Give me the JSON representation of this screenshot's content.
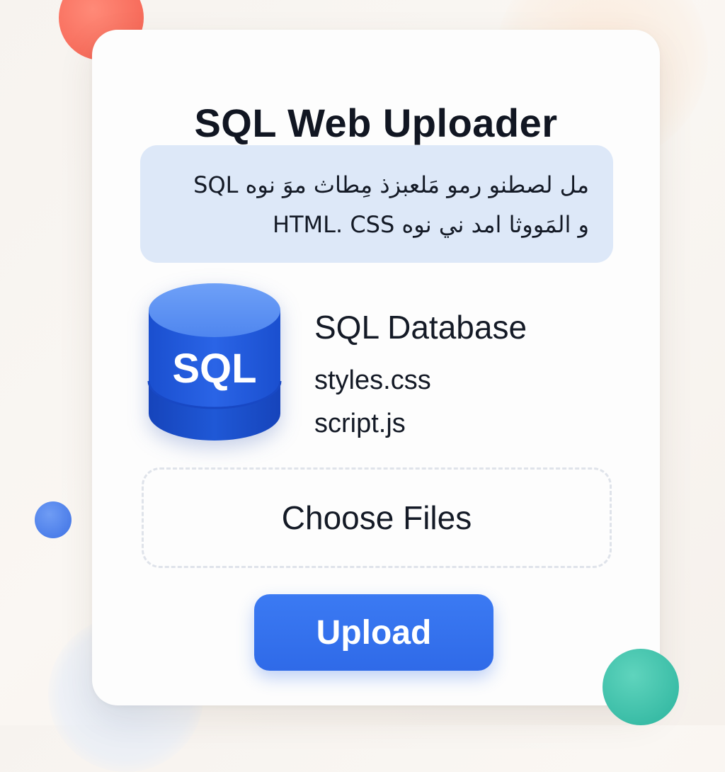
{
  "app": {
    "title": "SQL Web Uploader"
  },
  "info": {
    "line1": "مل لصطنو رمو مَلعبزذ مِطاث موَ نوه SQL",
    "line2": "و المَووثا امد ني نوه HTML. CSS"
  },
  "database": {
    "icon": "database-icon",
    "icon_text": "SQL",
    "title": "SQL Database",
    "files": [
      "styles.css",
      "script.js"
    ]
  },
  "dropzone": {
    "label": "Choose Files"
  },
  "actions": {
    "upload_label": "Upload"
  },
  "colors": {
    "accent": "#2f6ae8",
    "info_bg": "#dde8f8",
    "database_blue": "#2260de",
    "blob_red": "#f45f4f",
    "blob_teal": "#2bb39d",
    "blob_blue": "#3f73e6"
  }
}
